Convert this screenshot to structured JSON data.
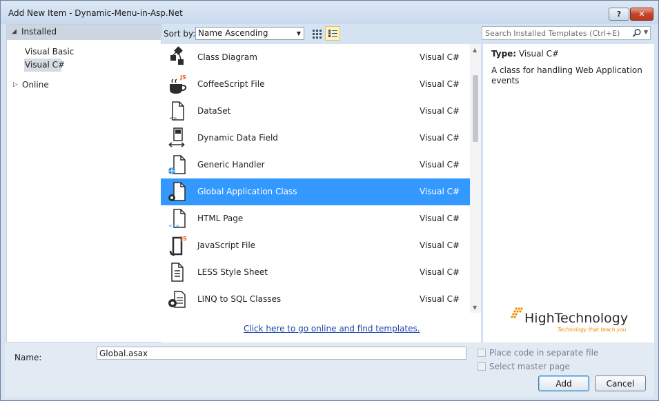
{
  "window": {
    "title": "Add New Item - Dynamic-Menu-in-Asp.Net",
    "help_label": "?",
    "close_label": "✕"
  },
  "tree": {
    "installed_label": "Installed",
    "children": [
      "Visual Basic",
      "Visual C#"
    ],
    "online_label": "Online"
  },
  "toolbar": {
    "sort_label": "Sort by:",
    "sort_value": "Name Ascending",
    "search_placeholder": "Search Installed Templates (Ctrl+E)"
  },
  "templates": [
    {
      "name": "Class Diagram",
      "lang": "Visual C#"
    },
    {
      "name": "CoffeeScript File",
      "lang": "Visual C#"
    },
    {
      "name": "DataSet",
      "lang": "Visual C#"
    },
    {
      "name": "Dynamic Data Field",
      "lang": "Visual C#"
    },
    {
      "name": "Generic Handler",
      "lang": "Visual C#"
    },
    {
      "name": "Global Application Class",
      "lang": "Visual C#"
    },
    {
      "name": "HTML Page",
      "lang": "Visual C#"
    },
    {
      "name": "JavaScript File",
      "lang": "Visual C#"
    },
    {
      "name": "LESS Style Sheet",
      "lang": "Visual C#"
    },
    {
      "name": "LINQ to SQL Classes",
      "lang": "Visual C#"
    }
  ],
  "selected_template": "Global Application Class",
  "online_link": "Click here to go online and find templates.",
  "details": {
    "type_label": "Type:",
    "type_value": "Visual C#",
    "description": "A class for handling Web Application events"
  },
  "logo": {
    "text": "HighTechnology",
    "tagline": "Technology that teach you"
  },
  "bottom": {
    "name_label": "Name:",
    "name_value": "Global.asax",
    "option_separate_file": "Place code in separate file",
    "option_master_page": "Select master page",
    "add_label": "Add",
    "cancel_label": "Cancel"
  },
  "colors": {
    "selection": "#3399ff",
    "link": "#1a44a6",
    "logo_orange": "#f28a00"
  }
}
